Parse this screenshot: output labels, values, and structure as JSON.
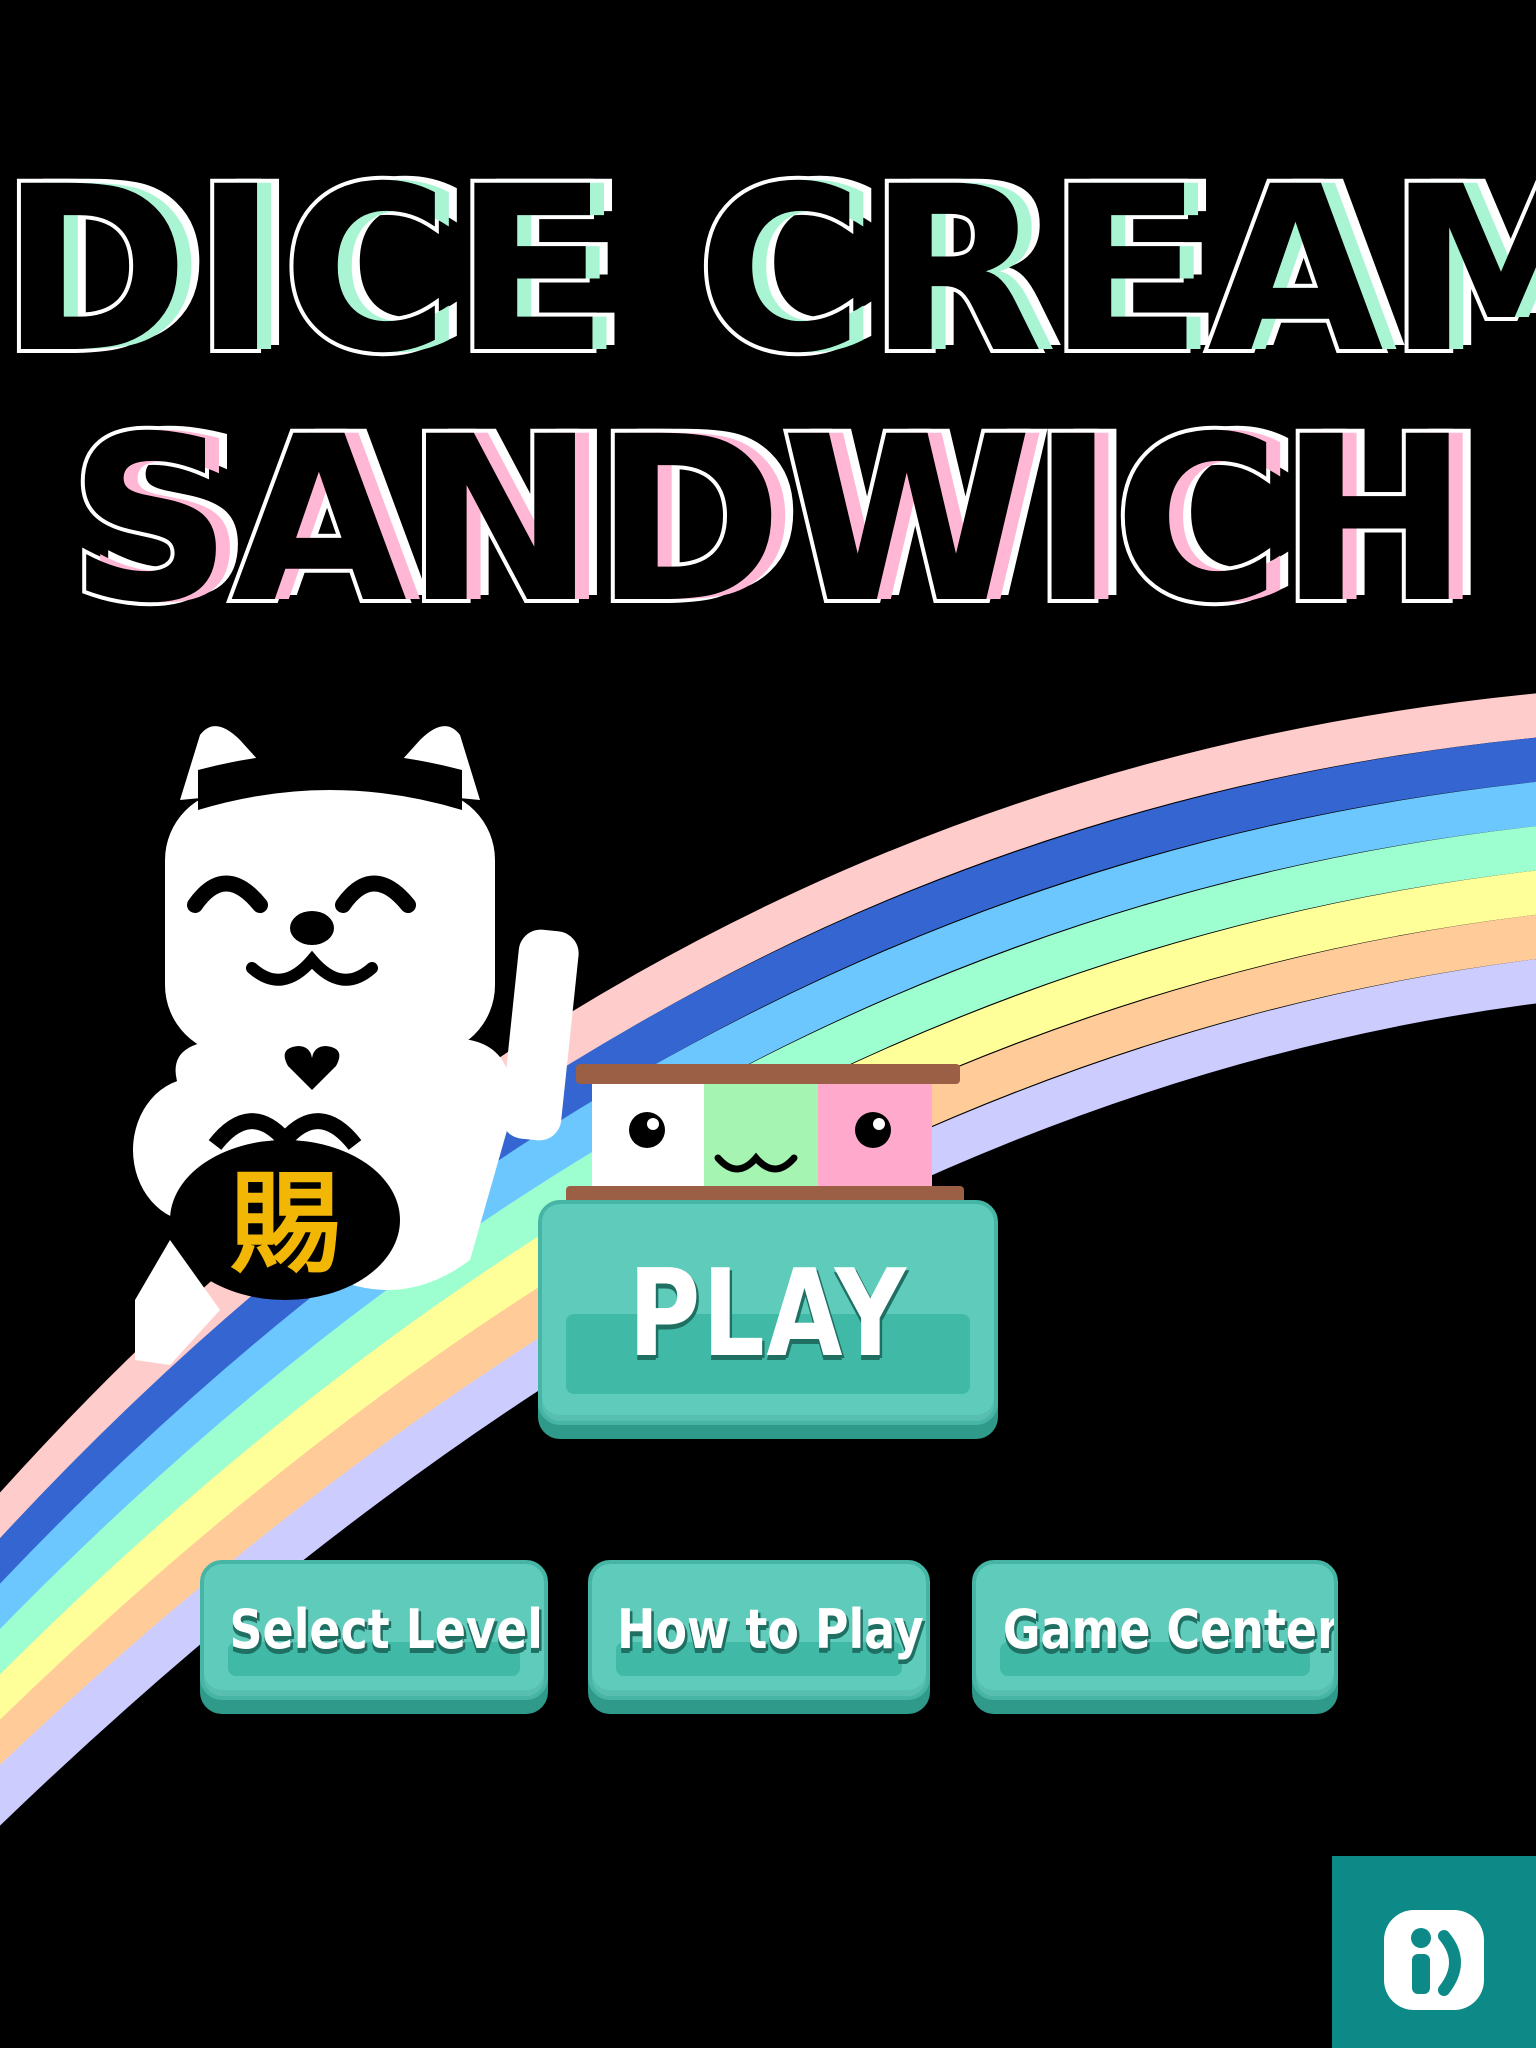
{
  "title": {
    "line1": "DICE CREAM",
    "line2": "SANDWICH"
  },
  "buttons": {
    "play": "PLAY",
    "select_level": "Select Level",
    "how_to_play": "How to Play",
    "game_center": "Game Center"
  },
  "mascot": {
    "coin_text": "賜"
  },
  "icons": {
    "mascot": "lucky-cat-icon",
    "sandwich": "ice-cream-sandwich-icon",
    "corner": "info-icon"
  },
  "colors": {
    "background": "#000000",
    "button_face": "#5ecbbb",
    "button_shadow": "#2f9a8a",
    "title_mint": "#a9f5d3",
    "title_pink": "#ffb7d5",
    "badge": "#0d8a88",
    "rainbow": [
      "#ffcccc",
      "#3465d0",
      "#6cc7ff",
      "#9dffcf",
      "#ffff99",
      "#ffcc99",
      "#ccccff"
    ]
  }
}
